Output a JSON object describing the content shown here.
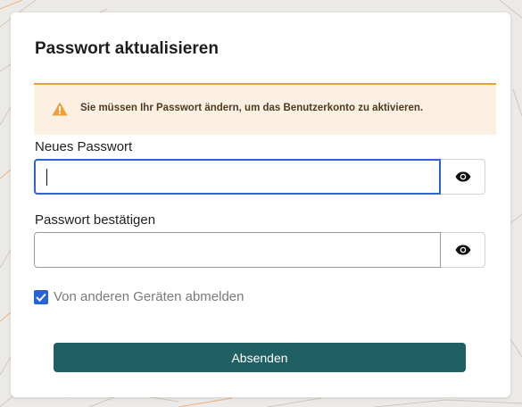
{
  "form": {
    "title": "Passwort aktualisieren",
    "alert": {
      "icon": "warning-icon",
      "message": "Sie müssen Ihr Passwort ändern, um das Benutzerkonto zu aktivieren."
    },
    "new_password": {
      "label": "Neues Passwort",
      "value": "",
      "toggle_icon": "eye-icon"
    },
    "confirm_password": {
      "label": "Passwort bestätigen",
      "value": "",
      "toggle_icon": "eye-icon"
    },
    "logout_others": {
      "label": "Von anderen Geräten abmelden",
      "checked": true
    },
    "submit_label": "Absenden"
  },
  "colors": {
    "accent": "#2563d9",
    "button": "#205f63",
    "alert_bg": "#fcf0e2",
    "alert_border": "#e8a03c",
    "warning_icon": "#e8a03c"
  }
}
